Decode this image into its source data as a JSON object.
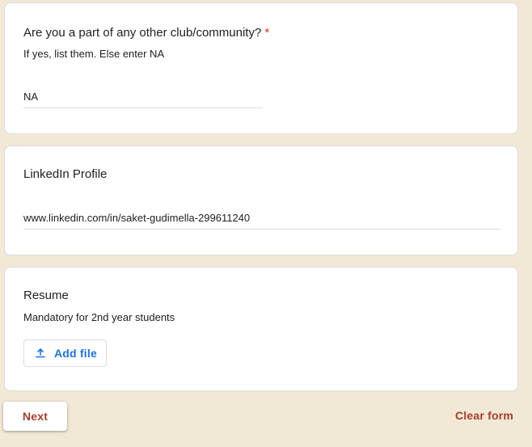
{
  "questions": {
    "club": {
      "title": "Are you a part of any other club/community?",
      "required_mark": "*",
      "description": "If yes, list them. Else enter NA",
      "value": "NA"
    },
    "linkedin": {
      "title": "LinkedIn Profile",
      "value": "www.linkedin.com/in/saket-gudimella-299611240"
    },
    "resume": {
      "title": "Resume",
      "description": "Mandatory for 2nd year students",
      "upload_label": "Add file",
      "upload_icon": "upload-icon"
    }
  },
  "footer": {
    "next_label": "Next",
    "clear_label": "Clear form"
  },
  "colors": {
    "background": "#f2e8d6",
    "accent": "#a63d2a",
    "link_blue": "#1a73e8",
    "required_red": "#d93025"
  }
}
